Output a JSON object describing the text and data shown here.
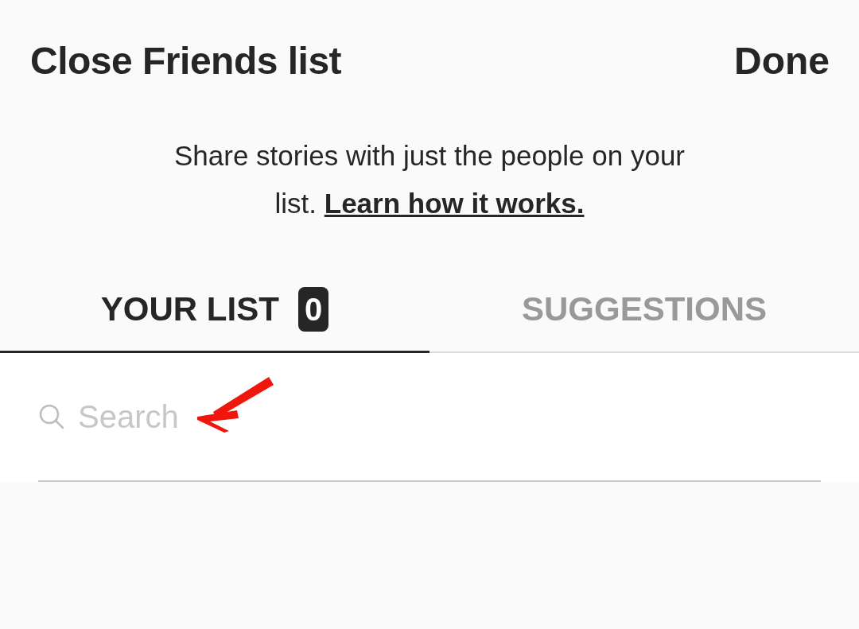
{
  "header": {
    "title": "Close Friends list",
    "done": "Done"
  },
  "description": {
    "text": "Share stories with just the people on your list.",
    "link": "Learn how it works."
  },
  "tabs": [
    {
      "label": "YOUR LIST",
      "count": "0",
      "selected": true
    },
    {
      "label": "SUGGESTIONS",
      "selected": false
    }
  ],
  "search": {
    "placeholder": "Search"
  }
}
